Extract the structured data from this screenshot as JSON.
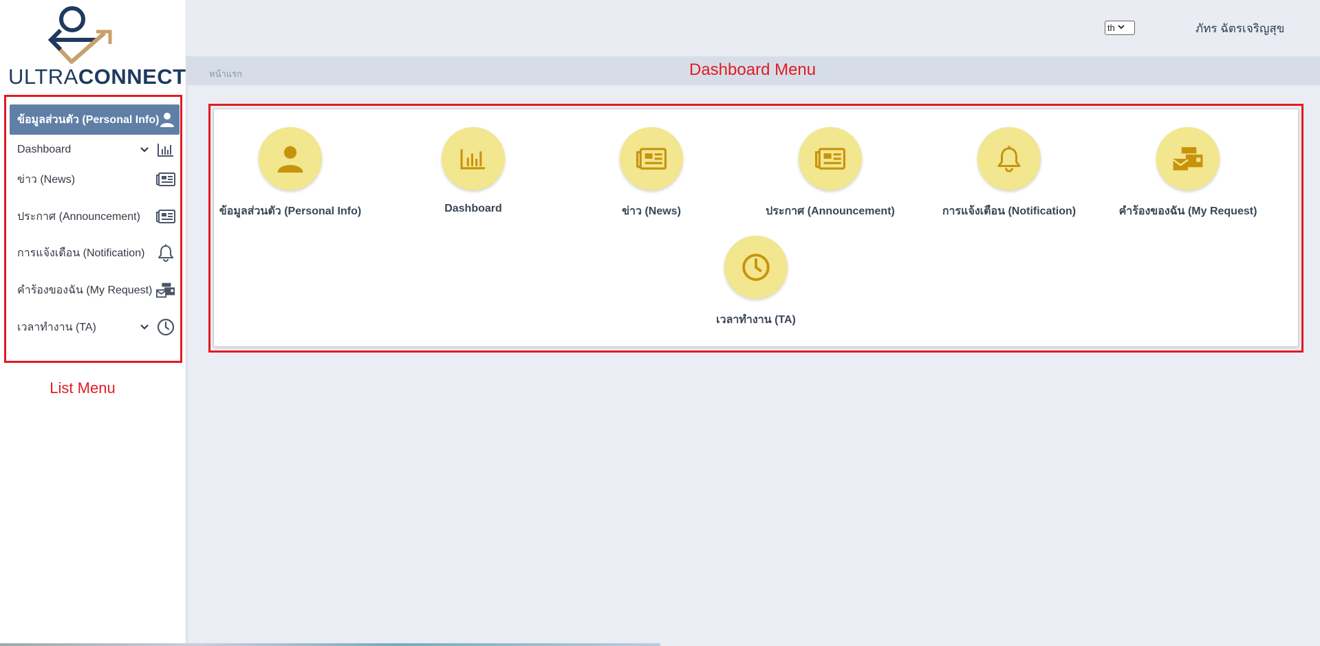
{
  "app": {
    "logo_text_light": "ULTRA",
    "logo_text_bold": "CONNECT"
  },
  "sidebar": {
    "items": [
      {
        "label": "ข้อมูลส่วนตัว (Personal Info)",
        "icon": "user-icon",
        "active": true,
        "has_chevron": false
      },
      {
        "label": "Dashboard",
        "icon": "bar-chart-icon",
        "active": false,
        "has_chevron": true
      },
      {
        "label": "ข่าว (News)",
        "icon": "newspaper-icon",
        "active": false,
        "has_chevron": false
      },
      {
        "label": "ประกาศ (Announcement)",
        "icon": "newspaper-icon",
        "active": false,
        "has_chevron": false
      },
      {
        "label": "การแจ้งเตือน (Notification)",
        "icon": "bell-icon",
        "active": false,
        "has_chevron": false
      },
      {
        "label": "คำร้องของฉัน (My Request)",
        "icon": "mail-bulk-icon",
        "active": false,
        "has_chevron": false
      },
      {
        "label": "เวลาทำงาน (TA)",
        "icon": "clock-icon",
        "active": false,
        "has_chevron": true
      }
    ],
    "annotation": "List Menu"
  },
  "topbar": {
    "language": "th",
    "username": "ภัทร ฉัตรเจริญสุข"
  },
  "breadcrumb": {
    "home": "หน้าแรก",
    "annotation": "Dashboard Menu"
  },
  "dashboard": {
    "tiles": [
      {
        "label": "ข้อมูลส่วนตัว (Personal Info)",
        "icon": "user-icon"
      },
      {
        "label": "Dashboard",
        "icon": "bar-chart-icon"
      },
      {
        "label": "ข่าว (News)",
        "icon": "newspaper-icon"
      },
      {
        "label": "ประกาศ (Announcement)",
        "icon": "newspaper-icon"
      },
      {
        "label": "การแจ้งเตือน (Notification)",
        "icon": "bell-icon"
      },
      {
        "label": "คำร้องของฉัน (My Request)",
        "icon": "mail-bulk-icon"
      },
      {
        "label": "เวลาทำงาน (TA)",
        "icon": "clock-icon"
      }
    ]
  },
  "colors": {
    "accent_red": "#e11b22",
    "active_menu": "#5f7fa6",
    "tile_circle": "#f2e68e",
    "tile_icon": "#c8930c",
    "logo_navy": "#1f3a5f",
    "logo_gold": "#c9a06a"
  }
}
